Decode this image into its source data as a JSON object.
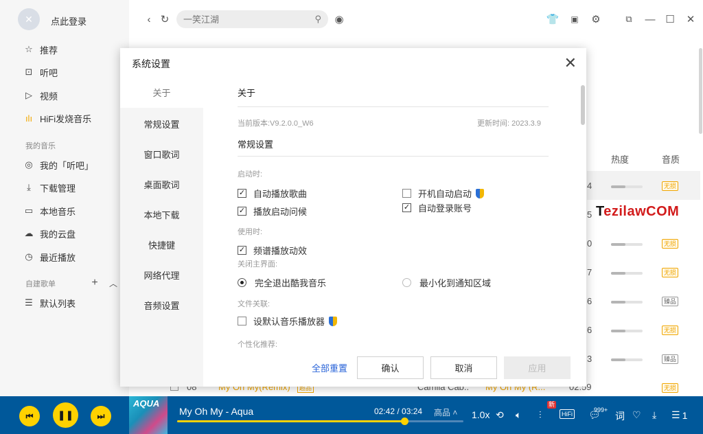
{
  "sidebar": {
    "login": "点此登录",
    "items": [
      {
        "label": "推荐",
        "icon": "star-icon"
      },
      {
        "label": "听吧",
        "icon": "radio-icon"
      },
      {
        "label": "视频",
        "icon": "video-icon"
      },
      {
        "label": "HiFi发烧音乐",
        "icon": "hifi-wave-icon"
      }
    ],
    "my_music_title": "我的音乐",
    "my_items": [
      {
        "label": "我的「听吧」",
        "icon": "headset-icon"
      },
      {
        "label": "下载管理",
        "icon": "download-icon"
      },
      {
        "label": "本地音乐",
        "icon": "monitor-icon"
      },
      {
        "label": "我的云盘",
        "icon": "cloud-icon"
      },
      {
        "label": "最近播放",
        "icon": "clock-icon"
      }
    ],
    "playlist_title": "自建歌单",
    "playlist_items": [
      {
        "label": "默认列表",
        "icon": "playlist-icon"
      }
    ]
  },
  "topbar": {
    "search_placeholder": "一笑江湖"
  },
  "list": {
    "col_heat": "热度",
    "col_quality": "音质",
    "rows": [
      {
        "num": "4",
        "heat": 0.45,
        "quality": "无损"
      },
      {
        "num": "5",
        "heat": 0.45,
        "quality": ""
      },
      {
        "num": "0",
        "heat": 0.45,
        "quality": "无损"
      },
      {
        "num": "7",
        "heat": 0.45,
        "quality": "无损"
      },
      {
        "num": "6",
        "heat": 0.45,
        "quality": "臻品"
      },
      {
        "num": "6",
        "heat": 0.45,
        "quality": "无损"
      },
      {
        "num": "3",
        "heat": 0.45,
        "quality": "臻品"
      },
      {
        "num": "",
        "heat": 0,
        "quality": "无损"
      }
    ],
    "watermark_first": "T",
    "watermark_rest": "ezilawCOM",
    "back_row": {
      "index": "08",
      "title": "My Oh My(Remix)",
      "tag": "超品",
      "artist": "Camila Cab..",
      "album": "My Oh My (R...",
      "duration": "02:59"
    }
  },
  "dialog": {
    "title": "系统设置",
    "nav": [
      "关于",
      "常规设置",
      "窗口歌词",
      "桌面歌词",
      "本地下载",
      "快捷键",
      "网络代理",
      "音频设置"
    ],
    "about_title": "关于",
    "version": "当前版本:V9.2.0.0_W6",
    "update_time": "更新时间: 2023.3.9",
    "general_title": "常规设置",
    "startup_label": "启动时:",
    "opt_autoplay": "自动播放歌曲",
    "opt_boot_start": "开机自动启动",
    "opt_greeting": "播放启动问候",
    "opt_autologin": "自动登录账号",
    "in_use_label": "使用时:",
    "opt_spectrum": "频谱播放动效",
    "close_main_label": "关闭主界面:",
    "opt_exit": "完全退出酷我音乐",
    "opt_minimize": "最小化到通知区域",
    "file_assoc_label": "文件关联:",
    "opt_default_player": "设默认音乐播放器",
    "personal_label": "个性化推荐:",
    "btn_reset": "全部重置",
    "btn_ok": "确认",
    "btn_cancel": "取消",
    "btn_apply": "应用"
  },
  "player": {
    "cover_text": "AQUA",
    "song": "My Oh My - Aqua",
    "time": "02:42 / 03:24",
    "progress": 0.794,
    "quality": "高品",
    "speed": "1.0x",
    "hifi": "HiFi",
    "new_badge": "新",
    "comments": "999+",
    "lyrics": "词",
    "playlist_count": "1"
  }
}
